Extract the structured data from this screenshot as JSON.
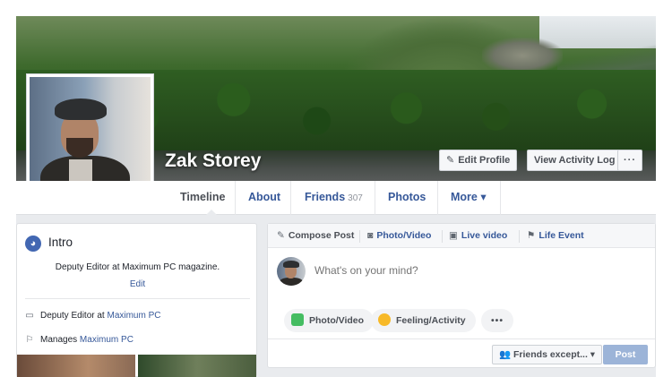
{
  "profile": {
    "name": "Zak Storey"
  },
  "cover_actions": {
    "edit_profile": "Edit Profile",
    "view_activity_log": "View Activity Log",
    "more": "···"
  },
  "tabs": [
    {
      "label": "Timeline"
    },
    {
      "label": "About"
    },
    {
      "label": "Friends",
      "count": "307"
    },
    {
      "label": "Photos"
    },
    {
      "label": "More ▾"
    }
  ],
  "intro": {
    "title": "Intro",
    "bio": "Deputy Editor at Maximum PC magazine.",
    "edit": "Edit",
    "job_prefix": "Deputy Editor at ",
    "job_link": "Maximum PC",
    "manages_prefix": "Manages ",
    "manages_link": "Maximum PC"
  },
  "composer": {
    "tabs": [
      {
        "label": "Compose Post",
        "icon": "pencil-icon"
      },
      {
        "label": "Photo/Video",
        "icon": "camera-icon"
      },
      {
        "label": "Live video",
        "icon": "video-icon"
      },
      {
        "label": "Life Event",
        "icon": "flag-icon"
      }
    ],
    "placeholder": "What's on your mind?",
    "actions": {
      "photo_video": "Photo/Video",
      "feeling_activity": "Feeling/Activity",
      "more": "•••"
    },
    "audience": "Friends except... ▾",
    "post": "Post"
  },
  "colors": {
    "brand": "#4267b2",
    "link": "#365899",
    "post_button": "#9cb4d8",
    "background": "#e9ebee"
  }
}
